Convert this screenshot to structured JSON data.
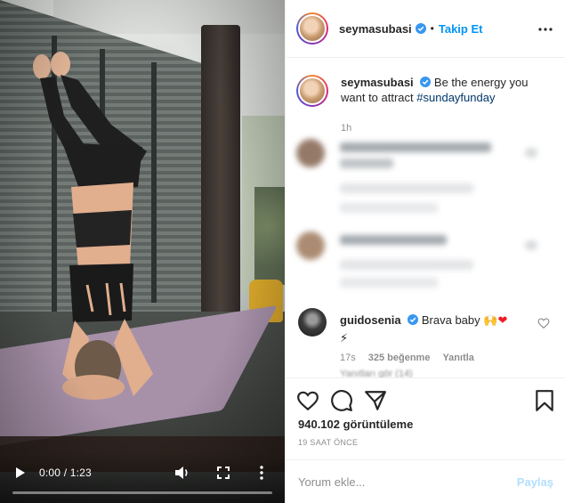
{
  "media": {
    "time_label": "0:00 / 1:23",
    "progress_fraction": 0.0
  },
  "header": {
    "username": "seymasubasi",
    "separator": "•",
    "follow_label": "Takip Et"
  },
  "caption": {
    "username": "seymasubasi",
    "text": "Be the energy you want to attract",
    "hashtag": "#sundayfunday",
    "meta": "1h"
  },
  "comment": {
    "username": "guidosenia",
    "text": "Brava baby",
    "emoji_hands": "🙌",
    "emoji_heart": "❤",
    "emoji_bolt": "⚡",
    "time": "17s",
    "likes": "325 beğenme",
    "reply_label": "Yanıtla",
    "replies_label": "Yanıtları gör (14)"
  },
  "actions": {
    "views": "940.102 görüntüleme",
    "ago": "19 SAAT ÖNCE"
  },
  "add_comment": {
    "placeholder": "Yorum ekle...",
    "post_label": "Paylaş"
  },
  "colors": {
    "link": "#0095f6",
    "hashtag": "#00376b",
    "muted": "#8e8e8e",
    "heart": "#ed1c24"
  },
  "icons": {
    "play": "play-icon",
    "volume": "volume-icon",
    "fullscreen": "fullscreen-icon",
    "more": "more-vertical-icon",
    "header_more": "more-horizontal-icon",
    "like": "heart-icon",
    "comment": "comment-icon",
    "share": "send-icon",
    "save": "bookmark-icon"
  }
}
